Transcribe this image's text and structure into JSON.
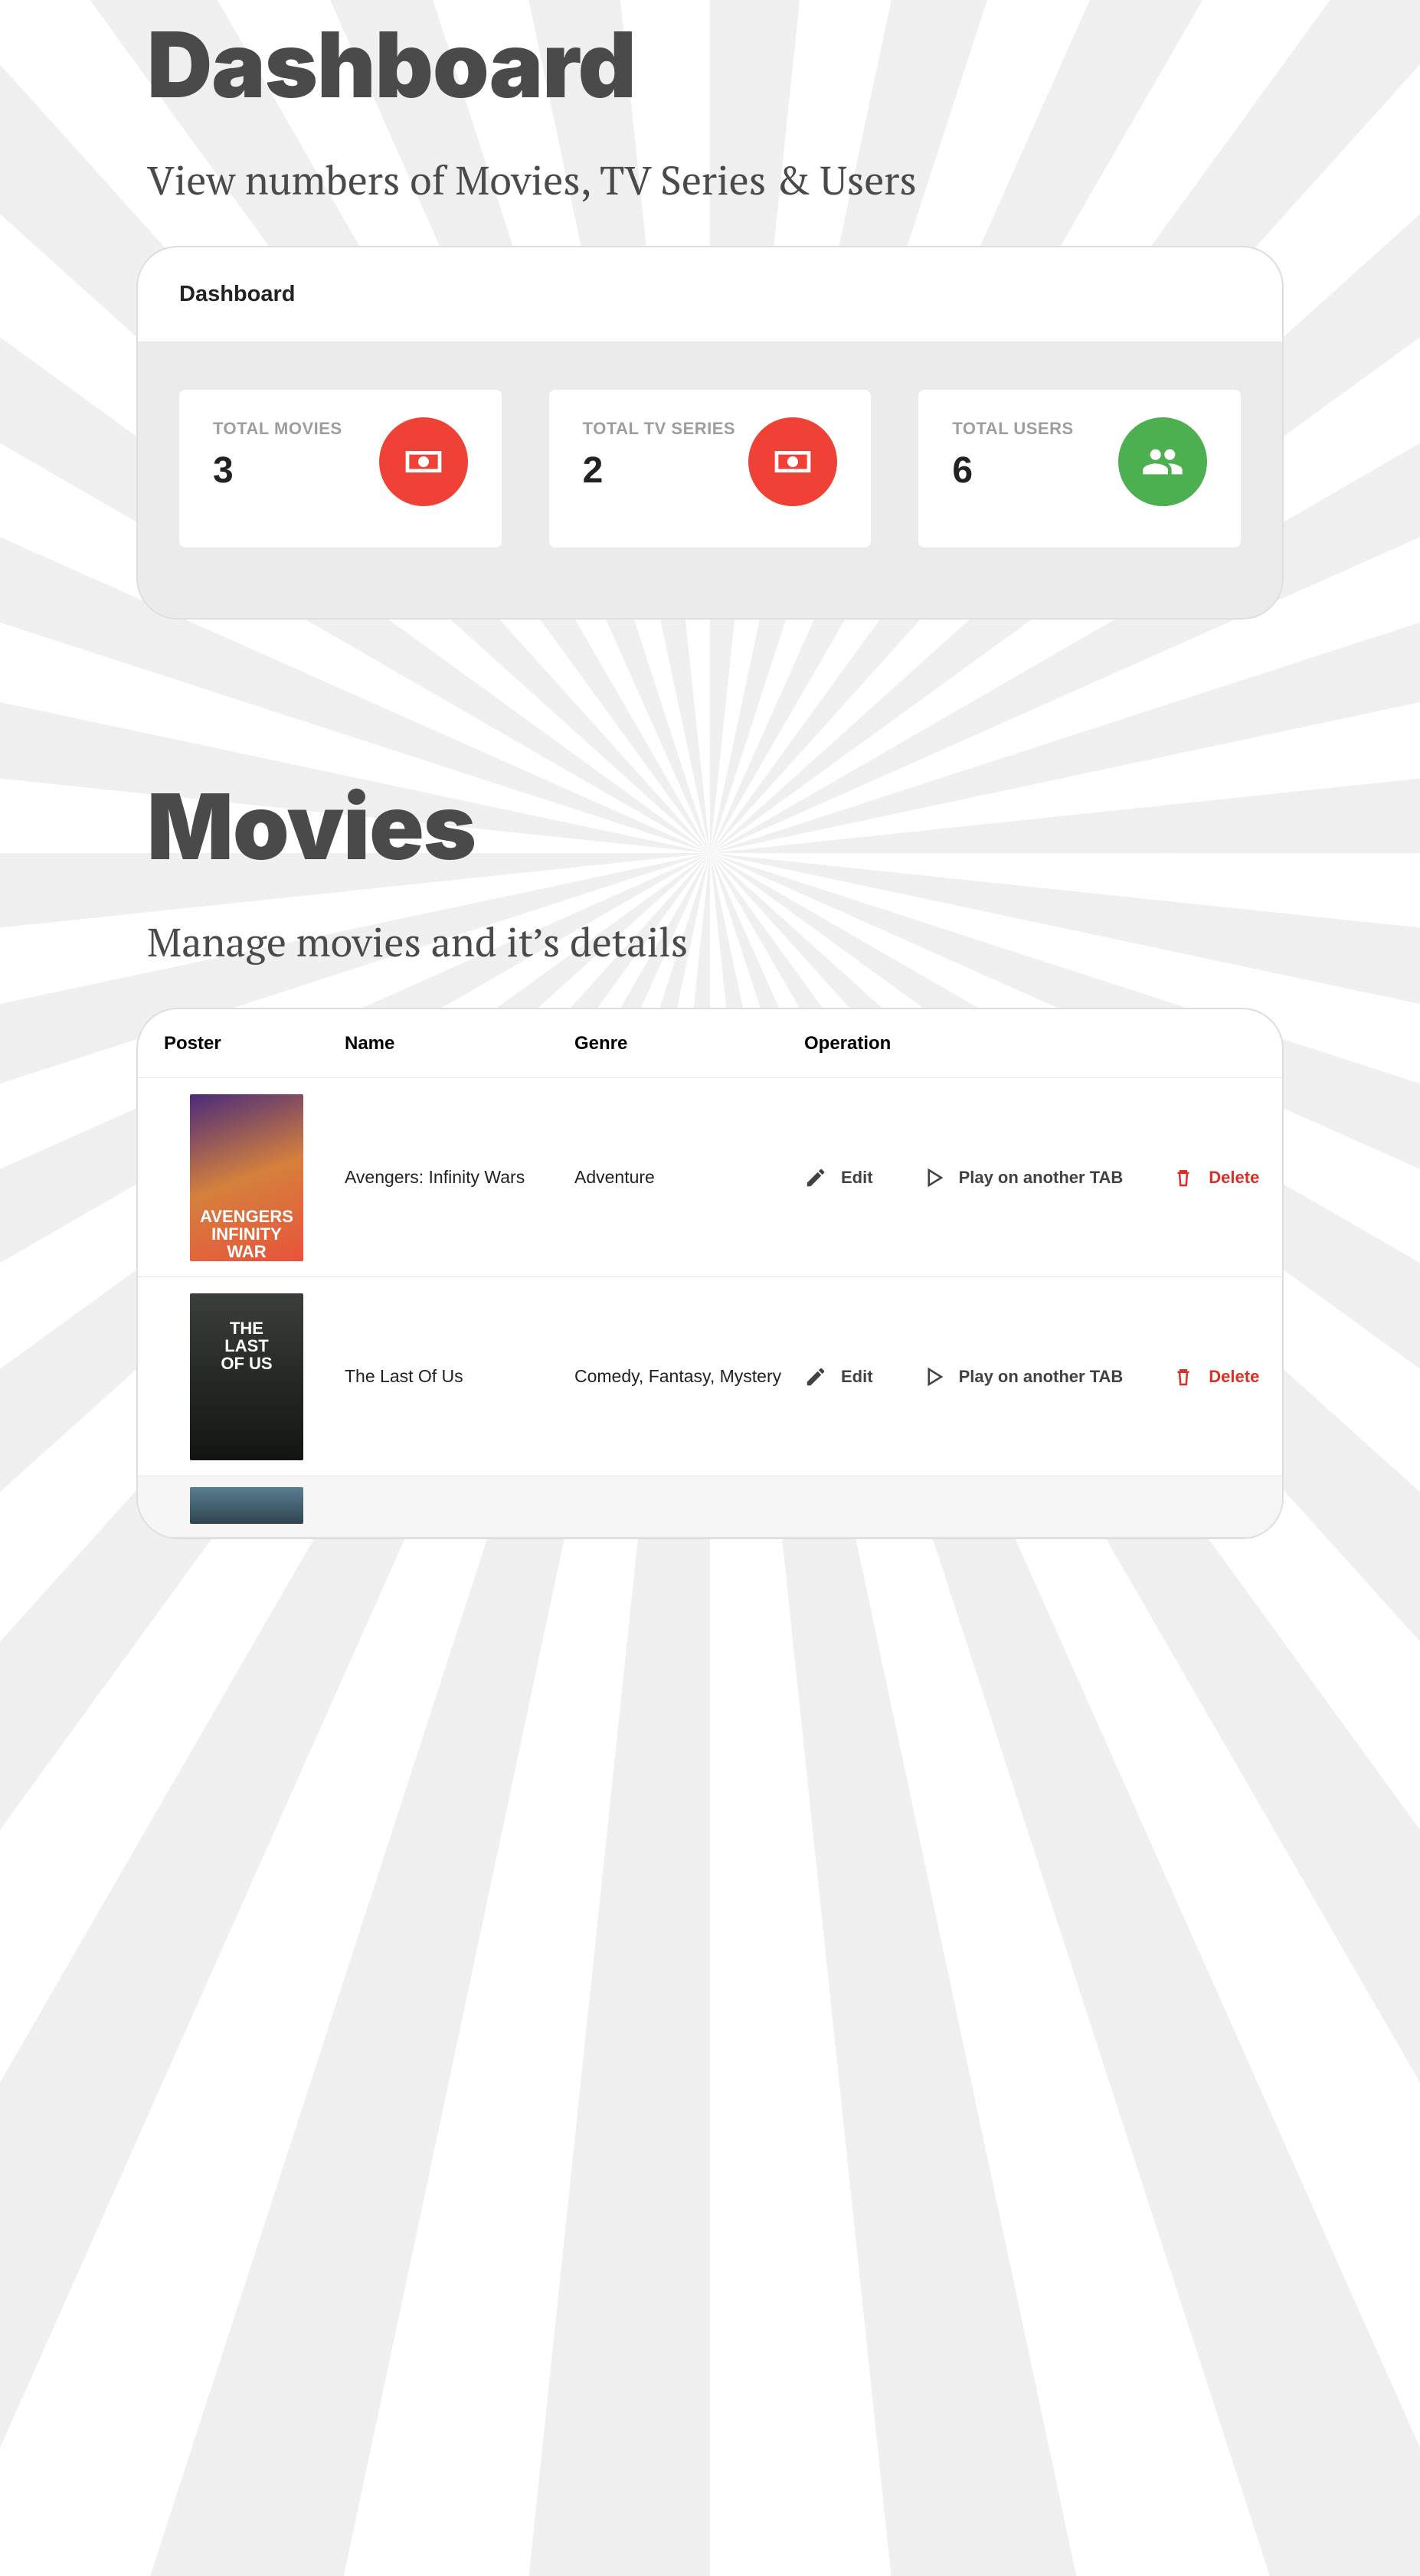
{
  "dashboard": {
    "title": "Dashboard",
    "subtitle": "View numbers of Movies, TV Series & Users",
    "card_title": "Dashboard",
    "stats": [
      {
        "label": "TOTAL MOVIES",
        "value": "3"
      },
      {
        "label": "TOTAL TV SERIES",
        "value": "2"
      },
      {
        "label": "TOTAL USERS",
        "value": "6"
      }
    ]
  },
  "movies": {
    "title": "Movies",
    "subtitle": "Manage movies and it’s details",
    "columns": {
      "poster": "Poster",
      "name": "Name",
      "genre": "Genre",
      "operation": "Operation"
    },
    "ops": {
      "edit": "Edit",
      "play": "Play on another TAB",
      "delete": "Delete"
    },
    "rows": [
      {
        "name": "Avengers: Infinity Wars",
        "genre": "Adventure"
      },
      {
        "name": "The Last Of Us",
        "genre": "Comedy, Fantasy, Mystery"
      }
    ]
  }
}
